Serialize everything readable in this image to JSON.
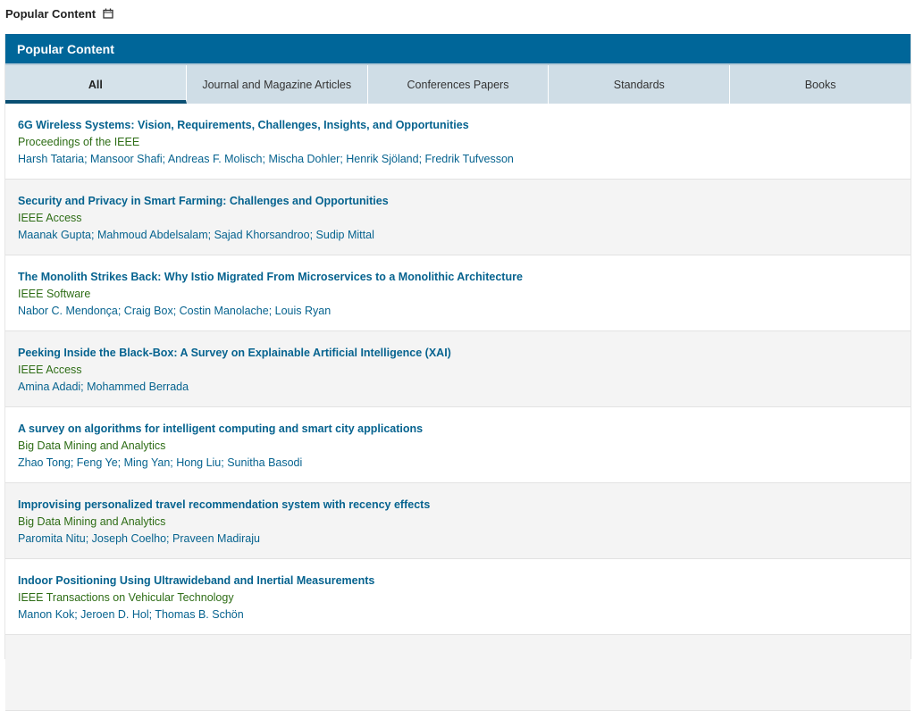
{
  "page": {
    "heading": "Popular Content",
    "heading_icon": "calendar-icon"
  },
  "panel": {
    "title": "Popular Content",
    "header_color": "#006699",
    "tabs": [
      {
        "label": "All",
        "active": true
      },
      {
        "label": "Journal and Magazine Articles",
        "active": false
      },
      {
        "label": "Conferences Papers",
        "active": false
      },
      {
        "label": "Standards",
        "active": false
      },
      {
        "label": "Books",
        "active": false
      }
    ]
  },
  "items": [
    {
      "title": "6G Wireless Systems: Vision, Requirements, Challenges, Insights, and Opportunities",
      "source": "Proceedings of the IEEE",
      "authors": "Harsh Tataria; Mansoor Shafi; Andreas F. Molisch; Mischa Dohler; Henrik Sjöland; Fredrik Tufvesson"
    },
    {
      "title": "Security and Privacy in Smart Farming: Challenges and Opportunities",
      "source": "IEEE Access",
      "authors": "Maanak Gupta; Mahmoud Abdelsalam; Sajad Khorsandroo; Sudip Mittal"
    },
    {
      "title": "The Monolith Strikes Back: Why Istio Migrated From Microservices to a Monolithic Architecture",
      "source": "IEEE Software",
      "authors": "Nabor C. Mendonça; Craig Box; Costin Manolache; Louis Ryan"
    },
    {
      "title": "Peeking Inside the Black-Box: A Survey on Explainable Artificial Intelligence (XAI)",
      "source": "IEEE Access",
      "authors": "Amina Adadi; Mohammed Berrada"
    },
    {
      "title": "A survey on algorithms for intelligent computing and smart city applications",
      "source": "Big Data Mining and Analytics",
      "authors": "Zhao Tong; Feng Ye; Ming Yan; Hong Liu; Sunitha Basodi"
    },
    {
      "title": "Improvising personalized travel recommendation system with recency effects",
      "source": "Big Data Mining and Analytics",
      "authors": "Paromita Nitu; Joseph Coelho; Praveen Madiraju"
    },
    {
      "title": "Indoor Positioning Using Ultrawideband and Inertial Measurements",
      "source": "IEEE Transactions on Vehicular Technology",
      "authors": "Manon Kok; Jeroen D. Hol; Thomas B. Schön"
    },
    {
      "title": "",
      "source": "",
      "authors": ""
    }
  ]
}
